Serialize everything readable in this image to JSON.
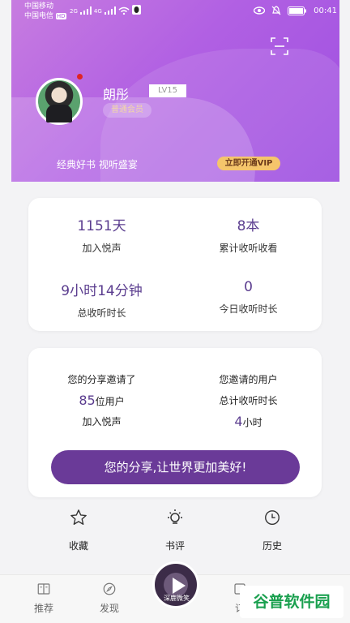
{
  "status_bar": {
    "carrier1": "中国移动",
    "carrier2": "中国电信",
    "hd": "HD",
    "network1": "2G",
    "network2": "4G",
    "time": "00:41"
  },
  "profile": {
    "username": "朗彤",
    "level": "LV15",
    "member_badge": "普通会员",
    "slogan": "经典好书 视听盛宴",
    "vip_button": "立即开通VIP"
  },
  "stats": [
    {
      "value": "1151天",
      "label": "加入悦声"
    },
    {
      "value": "8本",
      "label": "累计收听收看"
    },
    {
      "value": "9小时14分钟",
      "label": "总收听时长"
    },
    {
      "value": "0",
      "label": "今日收听时长"
    }
  ],
  "invite": {
    "left_line1": "您的分享邀请了",
    "left_num": "85",
    "left_unit": "位用户",
    "left_line3": "加入悦声",
    "right_line1": "您邀请的用户",
    "right_line2": "总计收听时长",
    "right_num": "4",
    "right_unit": "小时",
    "share_button": "您的分享,让世界更加美好!"
  },
  "actions": [
    {
      "label": "收藏",
      "icon": "star-icon"
    },
    {
      "label": "书评",
      "icon": "lightbulb-icon"
    },
    {
      "label": "历史",
      "icon": "clock-icon"
    }
  ],
  "tabs": [
    {
      "label": "推荐",
      "icon": "book-icon"
    },
    {
      "label": "发现",
      "icon": "compass-icon"
    },
    {
      "label": "订",
      "icon": "subscribe-icon"
    }
  ],
  "player_cover_text": "深鹿微笑",
  "watermark": "谷普软件园",
  "colors": {
    "header_start": "#c77ce0",
    "header_end": "#9d4fe0",
    "accent": "#6a3a98",
    "value_text": "#5b3d8f",
    "vip_gold": "#f5c56b"
  }
}
